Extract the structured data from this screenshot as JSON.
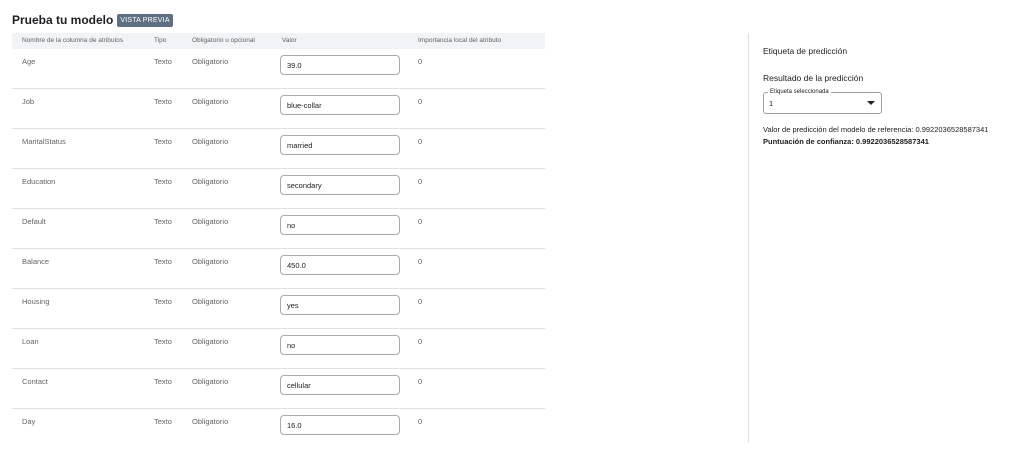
{
  "header": {
    "title": "Prueba tu modelo",
    "badge": "VISTA PREVIA"
  },
  "table": {
    "columns": {
      "name": "Nombre de la columna de atributos",
      "type": "Tipo",
      "required": "Obligatorio u opcional",
      "value": "Valor",
      "importance": "Importancia local del atributo"
    },
    "rows": [
      {
        "name": "Age",
        "type": "Texto",
        "required": "Obligatorio",
        "value": "39.0",
        "importance": "0"
      },
      {
        "name": "Job",
        "type": "Texto",
        "required": "Obligatorio",
        "value": "blue-collar",
        "importance": "0"
      },
      {
        "name": "MaritalStatus",
        "type": "Texto",
        "required": "Obligatorio",
        "value": "married",
        "importance": "0"
      },
      {
        "name": "Education",
        "type": "Texto",
        "required": "Obligatorio",
        "value": "secondary",
        "importance": "0"
      },
      {
        "name": "Default",
        "type": "Texto",
        "required": "Obligatorio",
        "value": "no",
        "importance": "0"
      },
      {
        "name": "Balance",
        "type": "Texto",
        "required": "Obligatorio",
        "value": "450.0",
        "importance": "0"
      },
      {
        "name": "Housing",
        "type": "Texto",
        "required": "Obligatorio",
        "value": "yes",
        "importance": "0"
      },
      {
        "name": "Loan",
        "type": "Texto",
        "required": "Obligatorio",
        "value": "no",
        "importance": "0"
      },
      {
        "name": "Contact",
        "type": "Texto",
        "required": "Obligatorio",
        "value": "cellular",
        "importance": "0"
      },
      {
        "name": "Day",
        "type": "Texto",
        "required": "Obligatorio",
        "value": "16.0",
        "importance": "0"
      }
    ]
  },
  "prediction": {
    "label_title": "Etiqueta de predicción",
    "result_title": "Resultado de la predicción",
    "select_label": "Etiqueta seleccionada",
    "selected_value": "1",
    "reference_value": "Valor de predicción del modelo de referencia: 0.9922036528587341",
    "confidence": "Puntuación de confianza: 0.9922036528587341"
  },
  "colors": {
    "badge_bg": "#5f6f83",
    "header_row_bg": "#f1f3f4"
  },
  "icons": {
    "select_caret": "caret-down-icon"
  }
}
